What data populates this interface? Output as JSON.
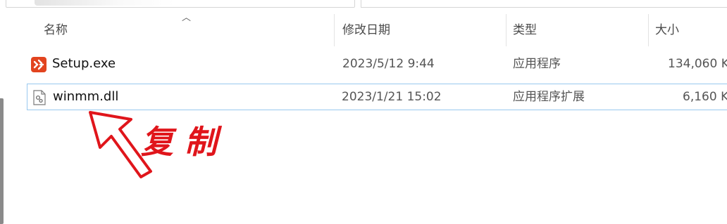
{
  "columns": {
    "name": "名称",
    "modified": "修改日期",
    "type": "类型",
    "size": "大小"
  },
  "files": [
    {
      "name": "Setup.exe",
      "modified": "2023/5/12 9:44",
      "type": "应用程序",
      "size": "134,060 K",
      "icon": "setup-app-icon",
      "selected": false
    },
    {
      "name": "winmm.dll",
      "modified": "2023/1/21 15:02",
      "type": "应用程序扩展",
      "size": "6,160 K",
      "icon": "dll-file-icon",
      "selected": true
    }
  ],
  "annotation": {
    "text": "复 制",
    "color": "#e0151b"
  },
  "colors": {
    "selection_border": "#99c9ef",
    "setup_icon": "#e2441f"
  }
}
